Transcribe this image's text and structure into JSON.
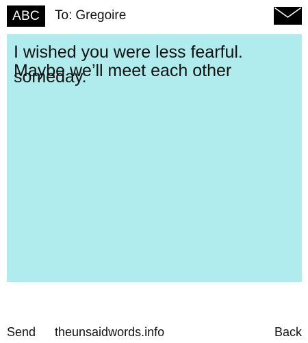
{
  "header": {
    "badge_label": "ABC",
    "to_prefix": "To:",
    "recipient": "Gregoire",
    "envelope_icon": "envelope-icon"
  },
  "note": {
    "background_color": "#b0eced",
    "line1": "I wished you were less fearful.",
    "line2": "someday.",
    "line3": "Maybe we’ll meet each other"
  },
  "footer": {
    "send_label": "Send",
    "site_label": "theunsaidwords.info",
    "back_label": "Back"
  }
}
